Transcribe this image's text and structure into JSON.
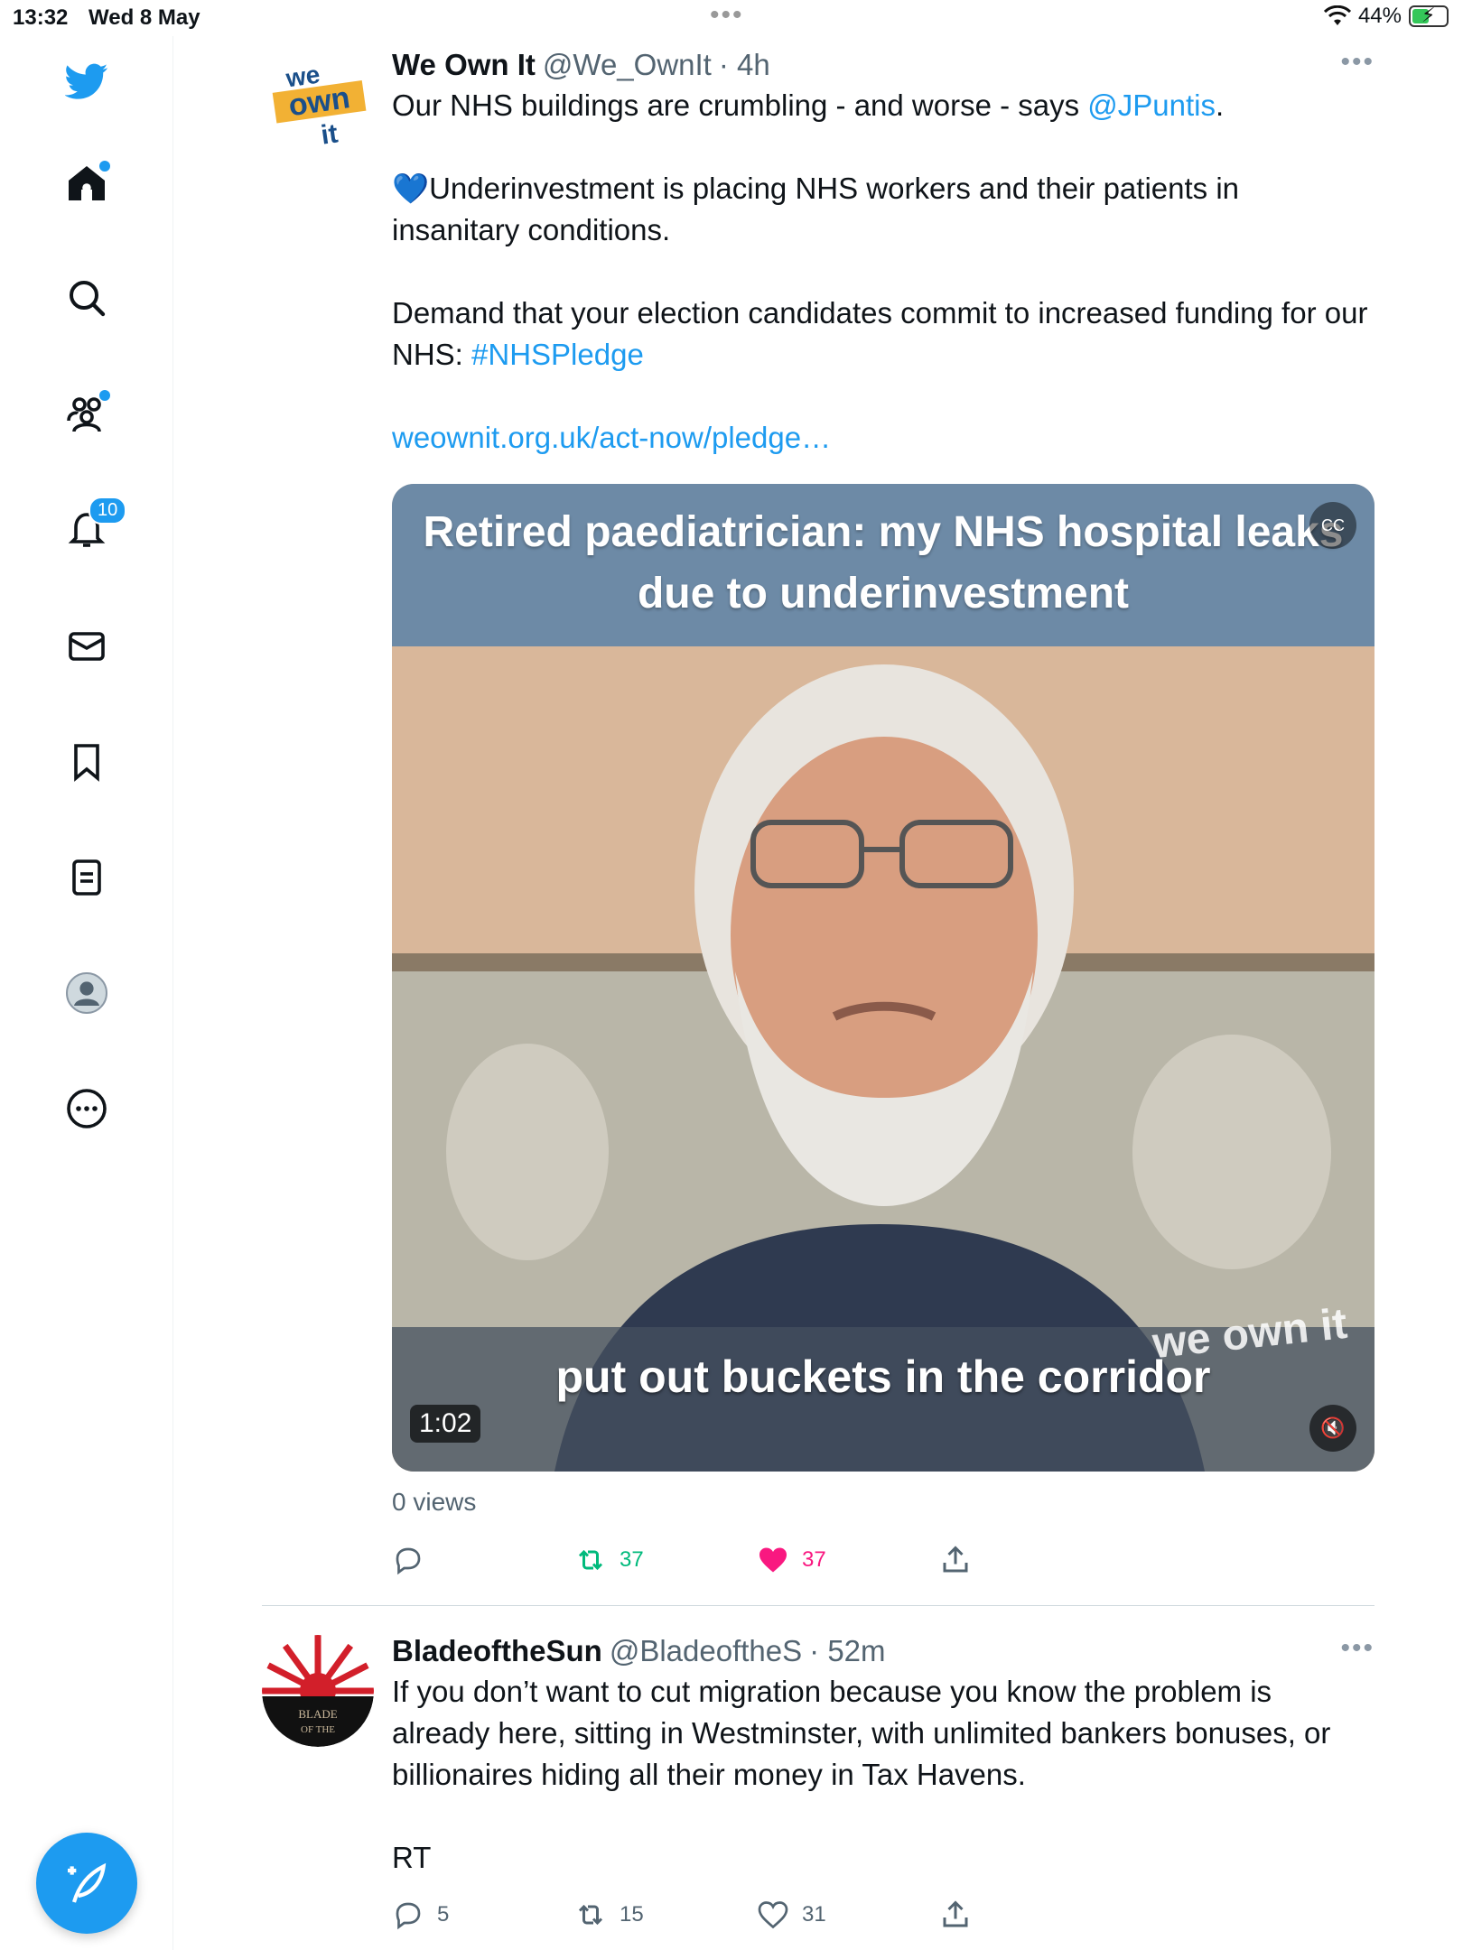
{
  "status_bar": {
    "time": "13:32",
    "date": "Wed 8 May",
    "battery": "44%"
  },
  "sidebar": {
    "notification_count": "10"
  },
  "tweets": [
    {
      "name": "We Own It",
      "handle": "@We_OwnIt",
      "time": "· 4h",
      "avatar_text": "we own it",
      "text_line1_a": "Our NHS buildings are crumbling - and worse - says ",
      "text_line1_mention": "@JPuntis",
      "text_line1_b": ".",
      "text_para2_emoji": "💙",
      "text_para2": "Underinvestment is placing NHS workers and their patients in insanitary conditions.",
      "text_para3_a": "Demand that your election candidates commit to increased funding for our NHS: ",
      "text_para3_hashtag": "#NHSPledge",
      "link": "weownit.org.uk/act-now/pledge…",
      "media": {
        "title": "Retired paediatrician: my NHS hospital leaks due to underinvestment",
        "caption": "put out buckets in the corridor",
        "duration": "1:02",
        "watermark": "we own it"
      },
      "views": "0 views",
      "replies": "",
      "retweets": "37",
      "likes": "37"
    },
    {
      "name": "BladeoftheSun",
      "handle": "@BladeoftheS",
      "time": "· 52m",
      "avatar_text": "BLADE OF THE SUN",
      "text_para1": "If you don’t want to cut migration because you know the problem is already here, sitting in Westminster, with unlimited bankers bonuses, or billionaires hiding all their money in Tax Havens.",
      "text_para2": "RT",
      "replies": "5",
      "retweets": "15",
      "likes": "31"
    }
  ],
  "colors": {
    "accent": "#1d9bf0",
    "retweet": "#00ba7c",
    "like": "#f91880"
  }
}
